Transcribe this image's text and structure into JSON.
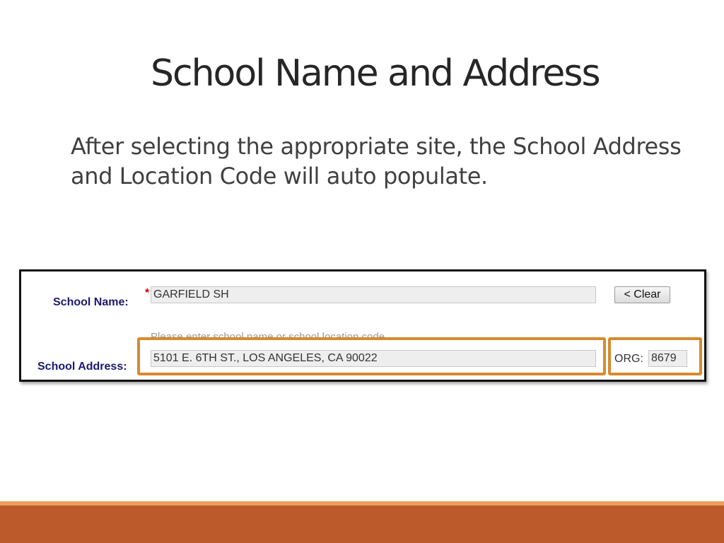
{
  "slide": {
    "title": "School Name and Address",
    "body": "After selecting the appropriate site, the School Address and Location Code will auto populate."
  },
  "form": {
    "school_name_label": "School Name:",
    "required_marker": "*",
    "school_name_value": "GARFIELD SH",
    "clear_button_label": "< Clear",
    "hint": "Please enter school name or school location code.",
    "school_address_label": "School Address:",
    "school_address_value": "5101 E. 6TH ST., LOS ANGELES, CA 90022",
    "org_label": "ORG:",
    "org_value": "8679"
  },
  "colors": {
    "highlight": "#d78a2e",
    "footer_bar": "#bc5a2b",
    "label_text": "#1a1a6e"
  }
}
